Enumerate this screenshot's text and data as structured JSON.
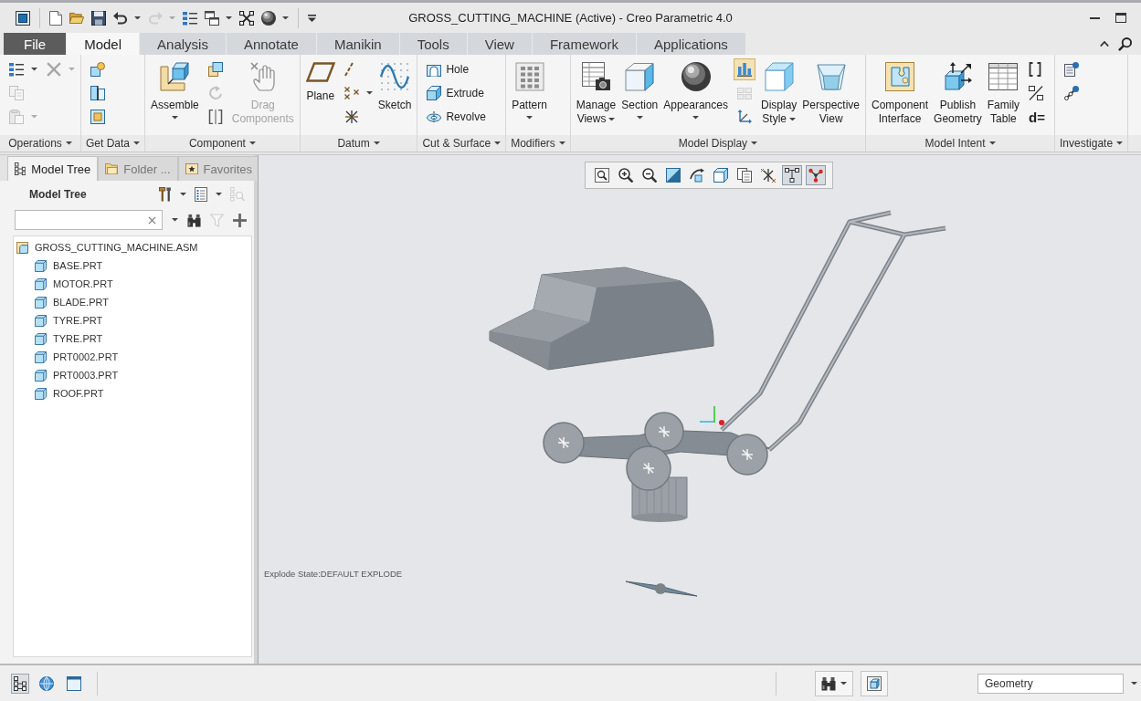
{
  "title_bar": {
    "title": "GROSS_CUTTING_MACHINE (Active) - Creo Parametric 4.0",
    "quick_access": [
      {
        "menu": false,
        "disabled": false
      },
      {
        "menu": false,
        "disabled": false
      },
      {
        "menu": false,
        "disabled": false
      },
      {
        "menu": true,
        "disabled": false
      },
      {
        "menu": true,
        "disabled": true
      },
      {
        "menu": false,
        "disabled": false
      },
      {
        "menu": true,
        "disabled": false
      },
      {
        "menu": false,
        "disabled": false
      },
      {
        "menu": true,
        "disabled": false
      }
    ]
  },
  "ribbon": {
    "tabs": [
      {
        "label": "File",
        "kind": "file",
        "selected": false
      },
      {
        "label": "Model",
        "kind": "tab",
        "selected": true
      },
      {
        "label": "Analysis",
        "kind": "tab",
        "selected": false
      },
      {
        "label": "Annotate",
        "kind": "tab",
        "selected": false
      },
      {
        "label": "Manikin",
        "kind": "tab",
        "selected": false
      },
      {
        "label": "Tools",
        "kind": "tab",
        "selected": false
      },
      {
        "label": "View",
        "kind": "tab",
        "selected": false
      },
      {
        "label": "Framework",
        "kind": "tab",
        "selected": false
      },
      {
        "label": "Applications",
        "kind": "tab",
        "selected": false
      }
    ],
    "groups": [
      {
        "label": "Operations",
        "items": [
          {
            "kind": "stack",
            "items": [
              {
                "menu": true,
                "disabled": false,
                "on": false
              },
              {
                "menu": false,
                "disabled": true,
                "on": false
              },
              {
                "menu": true,
                "disabled": true,
                "on": false
              }
            ]
          },
          {
            "kind": "stack",
            "items": [
              {
                "menu": true,
                "disabled": true,
                "on": false
              }
            ]
          }
        ]
      },
      {
        "label": "Get Data",
        "items": [
          {
            "kind": "stack",
            "items": [
              {
                "menu": false,
                "disabled": false,
                "on": false
              },
              {
                "menu": false,
                "disabled": false,
                "on": false
              },
              {
                "menu": false,
                "disabled": false,
                "on": false
              }
            ]
          }
        ]
      },
      {
        "label": "Component",
        "items": [
          {
            "kind": "large",
            "label": "Assemble",
            "menu": true,
            "disabled": false
          },
          {
            "kind": "stack",
            "items": [
              {
                "menu": false,
                "disabled": false,
                "on": false
              },
              {
                "menu": false,
                "disabled": true,
                "on": false
              },
              {
                "menu": false,
                "disabled": false,
                "on": false
              }
            ]
          },
          {
            "kind": "large",
            "label": "Drag Components",
            "menu": false,
            "disabled": true
          }
        ]
      },
      {
        "label": "Datum",
        "items": [
          {
            "kind": "large",
            "label": "Plane",
            "menu": false,
            "disabled": false
          },
          {
            "kind": "stack",
            "items": [
              {
                "menu": false,
                "disabled": false,
                "on": false
              },
              {
                "menu": true,
                "disabled": false,
                "on": false
              },
              {
                "menu": false,
                "disabled": false,
                "on": false
              }
            ]
          },
          {
            "kind": "large",
            "label": "Sketch",
            "menu": false,
            "disabled": false
          }
        ]
      },
      {
        "label": "Cut & Surface",
        "items": [
          {
            "kind": "stack",
            "items": [
              {
                "label": "Hole",
                "menu": false,
                "disabled": false,
                "on": false
              },
              {
                "label": "Extrude",
                "menu": false,
                "disabled": false,
                "on": false
              },
              {
                "label": "Revolve",
                "menu": false,
                "disabled": false,
                "on": false
              }
            ]
          }
        ]
      },
      {
        "label": "Modifiers",
        "items": [
          {
            "kind": "large",
            "label": "Pattern",
            "menu": true,
            "disabled": false
          }
        ]
      },
      {
        "label": "Model Display",
        "items": [
          {
            "kind": "large",
            "label": "Manage Views",
            "menu": true,
            "disabled": false
          },
          {
            "kind": "large",
            "label": "Section",
            "menu": true,
            "disabled": false
          },
          {
            "kind": "large",
            "label": "Appearances",
            "menu": true,
            "disabled": false
          },
          {
            "kind": "stack",
            "items": [
              {
                "menu": false,
                "disabled": false,
                "on": true
              },
              {
                "menu": false,
                "disabled": true,
                "on": false
              },
              {
                "menu": false,
                "disabled": false,
                "on": false
              }
            ]
          },
          {
            "kind": "large",
            "label": "Display Style",
            "menu": true,
            "disabled": false
          },
          {
            "kind": "large",
            "label": "Perspective View",
            "menu": false,
            "disabled": false
          }
        ]
      },
      {
        "label": "Model Intent",
        "items": [
          {
            "kind": "large",
            "label": "Component Interface",
            "menu": false,
            "disabled": false
          },
          {
            "kind": "large",
            "label": "Publish Geometry",
            "menu": false,
            "disabled": false
          },
          {
            "kind": "large",
            "label": "Family Table",
            "menu": false,
            "disabled": false
          },
          {
            "kind": "stack",
            "items": [
              {
                "menu": false,
                "disabled": false,
                "on": false
              },
              {
                "menu": false,
                "disabled": false,
                "on": false
              },
              {
                "glyph": "d=",
                "menu": false,
                "disabled": false,
                "on": false
              }
            ]
          }
        ]
      },
      {
        "label": "Investigate",
        "items": [
          {
            "kind": "stack",
            "items": [
              {
                "menu": false,
                "disabled": false,
                "on": false
              },
              {
                "menu": false,
                "disabled": false,
                "on": false
              }
            ]
          }
        ]
      }
    ]
  },
  "navigator": {
    "tabs": [
      {
        "label": "Model Tree",
        "selected": true
      },
      {
        "label": "Folder ...",
        "selected": false
      },
      {
        "label": "Favorites",
        "selected": false
      }
    ],
    "title": "Model Tree",
    "tree_tools": [
      {
        "menu": true,
        "disabled": false
      },
      {
        "menu": true,
        "disabled": false
      },
      {
        "menu": false,
        "disabled": true
      }
    ],
    "search_tools": [
      {
        "disabled": false
      },
      {
        "disabled": true
      },
      {
        "disabled": false
      }
    ],
    "tree": [
      {
        "label": "GROSS_CUTTING_MACHINE.ASM",
        "kind": "assembly",
        "children": [
          {
            "label": "BASE.PRT",
            "kind": "part"
          },
          {
            "label": "MOTOR.PRT",
            "kind": "part"
          },
          {
            "label": "BLADE.PRT",
            "kind": "part"
          },
          {
            "label": "TYRE.PRT",
            "kind": "part"
          },
          {
            "label": "TYRE.PRT",
            "kind": "part"
          },
          {
            "label": "PRT0002.PRT",
            "kind": "part"
          },
          {
            "label": "PRT0003.PRT",
            "kind": "part"
          },
          {
            "label": "ROOF.PRT",
            "kind": "part"
          }
        ]
      }
    ]
  },
  "graphics": {
    "view_toolbar": [
      {
        "on": false
      },
      {
        "on": false
      },
      {
        "on": false
      },
      {
        "on": false
      },
      {
        "on": false
      },
      {
        "on": false
      },
      {
        "on": false
      },
      {
        "on": false
      },
      {
        "on": true
      },
      {
        "on": true
      }
    ],
    "explode_state": "Explode State:DEFAULT EXPLODE"
  },
  "status_bar": {
    "toggles": [
      {
        "on": true
      },
      {
        "on": false
      },
      {
        "on": false
      }
    ],
    "selection_filter": {
      "value": "Geometry"
    }
  }
}
